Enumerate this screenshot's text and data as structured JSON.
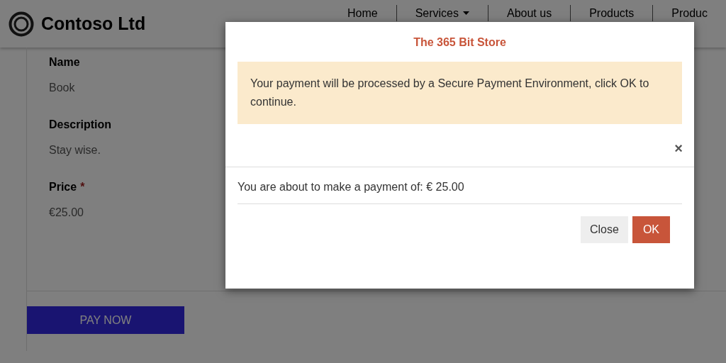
{
  "header": {
    "brand": "Contoso Ltd",
    "nav": [
      {
        "label": "Home",
        "kind": "link"
      },
      {
        "label": "Services",
        "kind": "dropdown"
      },
      {
        "label": "About us",
        "kind": "link"
      },
      {
        "label": "Products",
        "kind": "link"
      },
      {
        "label": "Produc",
        "kind": "link"
      }
    ]
  },
  "form": {
    "fields": [
      {
        "label": "Name",
        "value": "Book"
      },
      {
        "label": "Description",
        "value": "Stay wise."
      },
      {
        "label": "Price",
        "value": "€25.00",
        "required_mark": "*"
      }
    ],
    "button": "PAY NOW"
  },
  "modal": {
    "title": "The 365 Bit Store",
    "alert": "Your payment will be processed by a Secure Payment Environment, click OK to continue.",
    "close_icon": "×",
    "message": "You are about to make a payment of: € 25.00",
    "buttons": [
      {
        "label": "Close",
        "kind": "secondary"
      },
      {
        "label": "OK",
        "kind": "primary"
      }
    ]
  }
}
